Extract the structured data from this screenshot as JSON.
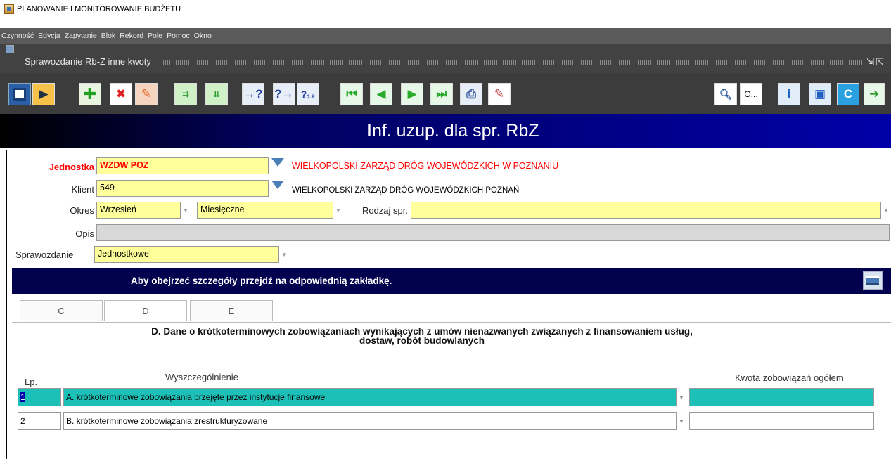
{
  "window": {
    "title": "PLANOWANIE I MONITOROWANIE BUDŻETU"
  },
  "menu": {
    "items": [
      "Czynność",
      "Edycja",
      "Zapytanie",
      "Blok",
      "Rekord",
      "Pole",
      "Pomoc",
      "Okno"
    ]
  },
  "document": {
    "title": "Sprawozdanie Rb-Z inne kwoty"
  },
  "toolbar": {
    "buttons_left": [
      "save-icon",
      "exit-icon",
      "insert-record-icon",
      "delete-record-icon",
      "clear-record-icon",
      "enter-query-icon",
      "execute-query-icon",
      "help-query-icon",
      "next-query-icon",
      "count-query-icon",
      "first-record-icon",
      "previous-record-icon",
      "next-record-icon",
      "last-record-icon",
      "print-icon",
      "edit-icon"
    ],
    "buttons_right": [
      "preview-icon",
      "info-icon",
      "document-icon",
      "window-icon",
      "calendar-icon",
      "exit-door-icon"
    ],
    "o_label": "O..."
  },
  "banner": {
    "title": "Inf. uzup. dla spr. RbZ"
  },
  "form": {
    "jednostka_label": "Jednostka",
    "jednostka_value": "WZDW POZ",
    "jednostka_desc": "WIELKOPOLSKI ZARZĄD DRÓG WOJEWÓDZKICH W POZNANIU",
    "klient_label": "Klient",
    "klient_value": "549",
    "klient_desc": "WIELKOPOLSKI ZARZĄD DRÓG WOJEWÓDZKICH POZNAŃ",
    "okres_label": "Okres",
    "okres_value": "Wrzesień",
    "okres_type_value": "Miesięczne",
    "rodzaj_label": "Rodzaj spr.",
    "rodzaj_value": "",
    "opis_label": "Opis",
    "opis_value": "",
    "sprawozdanie_label": "Sprawozdanie",
    "sprawozdanie_value": "Jednostkowe"
  },
  "info": {
    "message": "Aby obejrzeć szczegóły przejdź na odpowiednią zakładkę."
  },
  "tabs": [
    {
      "label": "C"
    },
    {
      "label": "D"
    },
    {
      "label": "E"
    }
  ],
  "section": {
    "title_line1": "D. Dane o krótkoterminowych zobowiązaniach wynikających z umów nienazwanych związanych z finansowaniem usług,",
    "title_line2": "dostaw, robót budowlanych"
  },
  "table": {
    "col_lp": "Lp.",
    "col_desc": "Wyszczególnienie",
    "col_amount": "Kwota zobowiązań ogółem",
    "rows": [
      {
        "lp": "1",
        "desc": "A. krótkoterminowe zobowiązania przejęte przez instytucje finansowe",
        "amount": ""
      },
      {
        "lp": "2",
        "desc": "B. krótkoterminowe zobowiązania zrestrukturyzowane",
        "amount": ""
      }
    ]
  },
  "colors": {
    "banner_end": "#0000a8",
    "field_bg": "#ffff9c",
    "active_row": "#1cc0b6",
    "info_bar": "#01014e",
    "label_red": "#ff0000"
  }
}
